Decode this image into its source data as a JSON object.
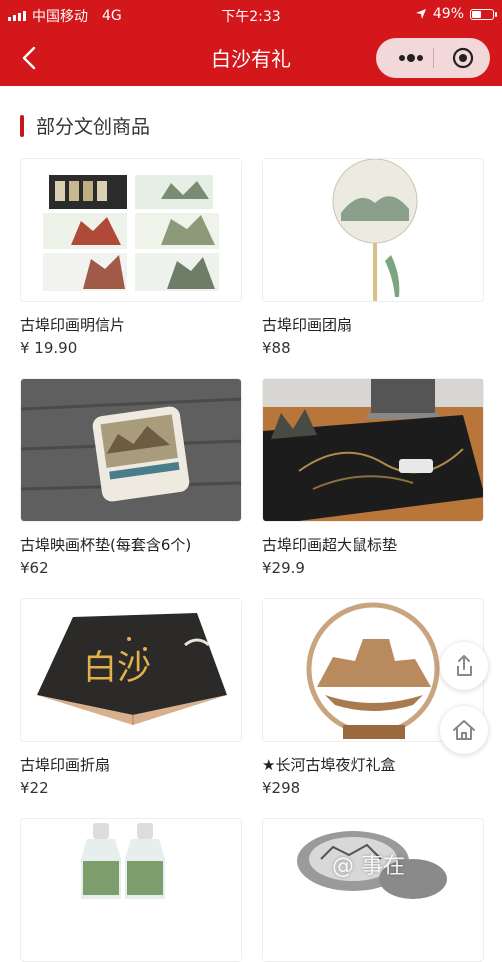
{
  "status_bar": {
    "carrier": "中国移动",
    "network": "4G",
    "time": "下午2:33",
    "battery": "49%",
    "battery_level": 0.49
  },
  "nav": {
    "title": "白沙有礼"
  },
  "section": {
    "title": "部分文创商品"
  },
  "products": [
    {
      "name": "古埠印画明信片",
      "price": "¥ 19.90"
    },
    {
      "name": "古埠印画团扇",
      "price": "¥88"
    },
    {
      "name": "古埠映画杯垫(每套含6个)",
      "price": "¥62"
    },
    {
      "name": "古埠印画超大鼠标垫",
      "price": "¥29.9"
    },
    {
      "name": "古埠印画折扇",
      "price": "¥22"
    },
    {
      "name": "★长河古埠夜灯礼盒",
      "price": "¥298"
    }
  ],
  "fan_text": "白沙",
  "watermark": "@ 事在",
  "icons": {
    "back": "chevron-left-icon",
    "more": "more-dots-icon",
    "close": "capsule-close-icon",
    "share": "share-icon",
    "home": "home-icon"
  },
  "colors": {
    "brand_red": "#d3171b",
    "accent_bar": "#c51619"
  }
}
